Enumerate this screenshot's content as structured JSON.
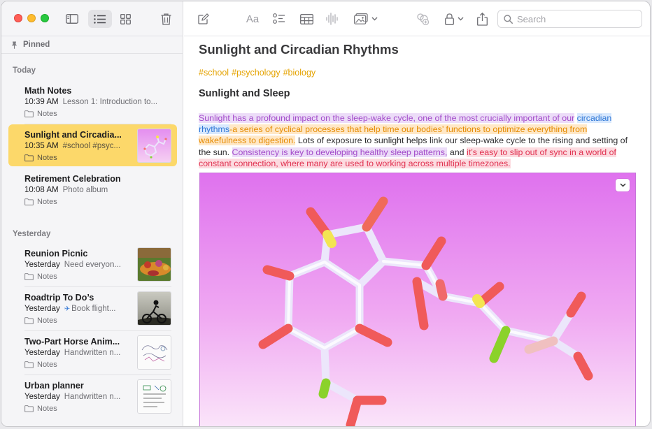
{
  "sidebar": {
    "pinned_label": "Pinned",
    "sections": {
      "today": "Today",
      "yesterday": "Yesterday"
    },
    "notes": [
      {
        "title": "Math Notes",
        "time": "10:39 AM",
        "preview": "Lesson 1: Introduction to...",
        "folder": "Notes",
        "has_thumb": false,
        "selected": false
      },
      {
        "title": "Sunlight and Circadia...",
        "time": "10:35 AM",
        "preview": "#school #psyc...",
        "folder": "Notes",
        "has_thumb": true,
        "selected": true
      },
      {
        "title": "Retirement Celebration",
        "time": "10:08 AM",
        "preview": "Photo album",
        "folder": "Notes",
        "has_thumb": false,
        "selected": false
      },
      {
        "title": "Reunion Picnic",
        "time": "Yesterday",
        "preview": "Need everyon...",
        "folder": "Notes",
        "has_thumb": true,
        "selected": false
      },
      {
        "title": "Roadtrip To Do’s",
        "time": "Yesterday",
        "preview": "Book flight...",
        "folder": "Notes",
        "has_thumb": true,
        "selected": false
      },
      {
        "title": "Two-Part Horse Anim...",
        "time": "Yesterday",
        "preview": "Handwritten n...",
        "folder": "Notes",
        "has_thumb": true,
        "selected": false
      },
      {
        "title": "Urban planner",
        "time": "Yesterday",
        "preview": "Handwritten n...",
        "folder": "Notes",
        "has_thumb": true,
        "selected": false
      }
    ]
  },
  "toolbar": {
    "format_label": "Aa",
    "search_placeholder": "Search"
  },
  "doc": {
    "title": "Sunlight and Circadian Rhythms",
    "tags": [
      "#school",
      "#psychology",
      "#biology"
    ],
    "heading": "Sunlight and Sleep",
    "paragraph": {
      "s1": "Sunlight has a profound impact on the sleep-wake cycle, one of the most crucially important of our",
      "s2": "circadian rhythms",
      "s3": "-a series of cyclical processes that help time our bodies’ functions to optimize everything from wakefulness to digestion.",
      "s4": " Lots of exposure to sunlight helps link our sleep-wake cycle to the rising and setting of the sun. ",
      "s5": "Consistency is key to developing healthy sleep patterns,",
      "s6": " and ",
      "s7": "it’s easy to slip out of sync in a world of constant connection, where many are used to working across multiple timezones."
    }
  },
  "colors": {
    "selected_note": "#fcd86a",
    "tag_orange": "#e5a300",
    "highlight_purple": "#a24ac9",
    "highlight_blue": "#2f77d6",
    "highlight_orange": "#e58a00",
    "highlight_pink": "#e0304f"
  },
  "icons": [
    "sidebar-toggle-icon",
    "list-view-icon",
    "gallery-view-icon",
    "trash-icon",
    "compose-icon",
    "checklist-icon",
    "table-icon",
    "audio-waveform-icon",
    "media-icon",
    "collaborate-icon",
    "lock-icon",
    "share-icon",
    "search-icon",
    "pin-icon",
    "folder-icon"
  ]
}
